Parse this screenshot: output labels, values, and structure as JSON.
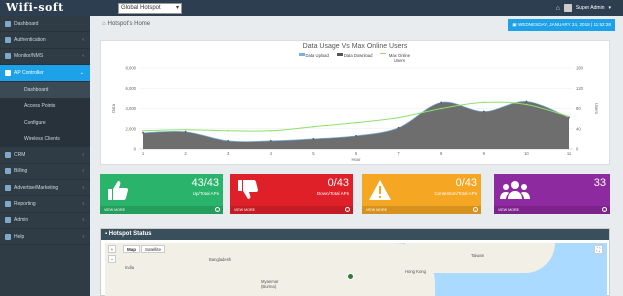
{
  "app": {
    "logo": "Wifi-soft"
  },
  "topbar": {
    "site_select": "Global Hotspot",
    "user": "Super Admin"
  },
  "sidebar": {
    "items": [
      {
        "label": "Dashboard"
      },
      {
        "label": "Authentication"
      },
      {
        "label": "Monitor/NMS"
      },
      {
        "label": "AP Controller"
      },
      {
        "label": "CRM"
      },
      {
        "label": "Billing"
      },
      {
        "label": "Advertise/Marketing"
      },
      {
        "label": "Reporting"
      },
      {
        "label": "Admin"
      },
      {
        "label": "Help"
      }
    ],
    "sub": [
      {
        "label": "Dashboard"
      },
      {
        "label": "Access Points"
      },
      {
        "label": "Configure"
      },
      {
        "label": "Wireless Clients"
      }
    ]
  },
  "breadcrumb": {
    "label": "Hotspot's Home"
  },
  "date_badge": "WEDNESDAY, JANUARY 24, 2018 | 11:52:28",
  "chart_data": {
    "type": "line",
    "title": "Data Usage Vs Max Online Users",
    "xlabel": "Hour",
    "ylabel": "Data",
    "y2label": "Users",
    "x": [
      1,
      2,
      3,
      4,
      5,
      6,
      7,
      8,
      9,
      10,
      11
    ],
    "ylim": [
      0,
      8000
    ],
    "y_ticks": [
      "0",
      "2,000",
      "4,000",
      "6,000",
      "8,000"
    ],
    "y2lim": [
      0,
      160
    ],
    "y2_ticks": [
      "0",
      "40",
      "80",
      "120",
      "160"
    ],
    "series": [
      {
        "name": "Data Upload",
        "color": "#7ab0e0",
        "values": [
          1600,
          1700,
          800,
          800,
          1000,
          1300,
          2100,
          4600,
          3700,
          4700,
          3100
        ]
      },
      {
        "name": "Data Download",
        "color": "#555555",
        "values": [
          1600,
          1700,
          800,
          800,
          1000,
          1300,
          2100,
          4600,
          3700,
          4700,
          3100
        ]
      },
      {
        "name": "Max Online Users",
        "color": "#8ee06b",
        "values": [
          36,
          38,
          36,
          36,
          44,
          52,
          62,
          80,
          92,
          88,
          64
        ]
      }
    ],
    "legend": "top-center",
    "grid": true
  },
  "cards": [
    {
      "value": "43/43",
      "label": "Up/Total APs",
      "footer": "VIEW MORE",
      "color": "#2ab36a",
      "icon": "thumbs-up-icon"
    },
    {
      "value": "0/43",
      "label": "Down/Total APs",
      "footer": "VIEW MORE",
      "color": "#df2029",
      "icon": "thumbs-down-icon"
    },
    {
      "value": "0/43",
      "label": "Contention/Total APs",
      "footer": "VIEW MORE",
      "color": "#f5a623",
      "icon": "warning-icon"
    },
    {
      "value": "33",
      "label": "",
      "footer": "VIEW MORE",
      "color": "#8e2aa0",
      "icon": "users-icon"
    }
  ],
  "map": {
    "title": "Hotspot Status",
    "tab_map": "Map",
    "tab_sat": "Satellite",
    "labels": [
      "Bangladesh",
      "India",
      "Myanmar (Burma)",
      "Taiwan",
      "Hong Kong"
    ]
  }
}
